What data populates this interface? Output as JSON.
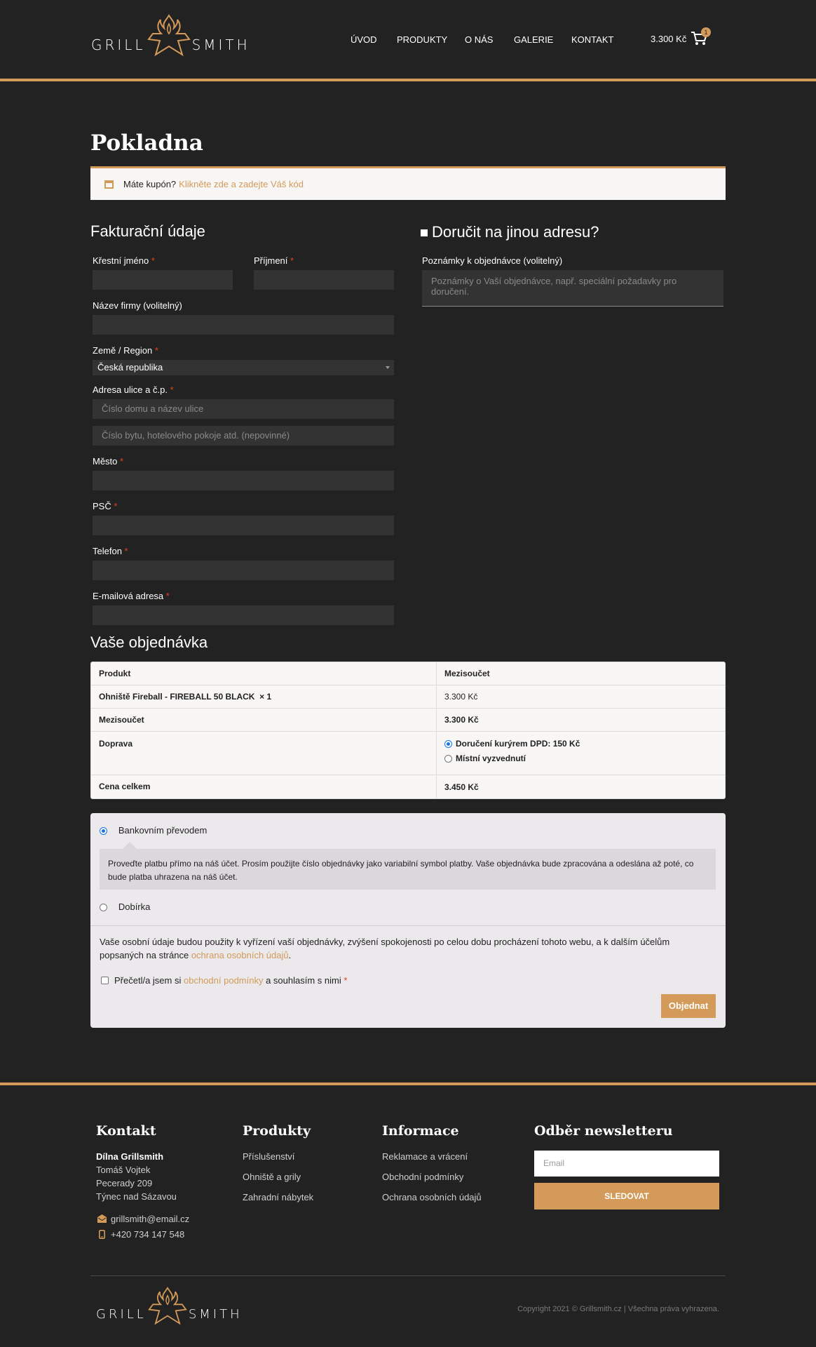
{
  "brand": {
    "left_word": "GRILL",
    "right_word": "SMITH"
  },
  "nav": {
    "items": [
      "ÚVOD",
      "PRODUKTY",
      "O NÁS",
      "GALERIE",
      "KONTAKT"
    ],
    "cart_amount": "3.300 Kč",
    "cart_count": "1"
  },
  "page_title": "Pokladna",
  "coupon": {
    "text": "Máte kupón?",
    "link": "Klikněte zde a zadejte Váš kód"
  },
  "billing": {
    "title": "Fakturační údaje",
    "first_name_label": "Křestní jméno",
    "last_name_label": "Příjmení",
    "company_label": "Název firmy (volitelný)",
    "country_label": "Země / Region",
    "country_value": "Česká republika",
    "street_label": "Adresa ulice a č.p.",
    "street_placeholder": "Číslo domu a název ulice",
    "street2_placeholder": "Číslo bytu, hotelového pokoje atd. (nepovinné)",
    "city_label": "Město",
    "zip_label": "PSČ",
    "phone_label": "Telefon",
    "email_label": "E-mailová adresa",
    "required_mark": "*"
  },
  "shipping": {
    "title": "Doručit na jinou adresu?",
    "notes_label": "Poznámky k objednávce (volitelný)",
    "notes_placeholder": "Poznámky o Vaší objednávce, např. speciální požadavky pro doručení."
  },
  "order": {
    "title": "Vaše objednávka",
    "col_product": "Produkt",
    "col_subtotal": "Mezisoučet",
    "item_name": "Ohniště Fireball - FIREBALL 50 BLACK",
    "item_qty": "× 1",
    "item_price": "3.300 Kč",
    "subtotal_label": "Mezisoučet",
    "subtotal_value": "3.300 Kč",
    "shipping_label": "Doprava",
    "shipping_option_1": "Doručení kurýrem DPD: 150 Kč",
    "shipping_option_2": "Místní vyzvednutí",
    "total_label": "Cena celkem",
    "total_value": "3.450 Kč"
  },
  "payment": {
    "option_1": "Bankovním převodem",
    "option_1_desc": "Proveďte platbu přímo na náš účet. Prosím použijte číslo objednávky jako variabilní symbol platby. Vaše objednávka bude zpracována a odeslána až poté, co bude platba uhrazena na náš účet.",
    "option_2": "Dobírka",
    "privacy_text": "Vaše osobní údaje budou použity k vyřízení vaší objednávky, zvýšení spokojenosti po celou dobu procházení tohoto webu, a k dalším účelům popsaných na stránce",
    "privacy_link": "ochrana osobních údajů",
    "privacy_end": ".",
    "terms_pre": "Přečetl/a jsem si",
    "terms_link": "obchodní podmínky",
    "terms_post": "a souhlasím s nimi",
    "button": "Objednat"
  },
  "footer": {
    "contact_title": "Kontakt",
    "contact_name": "Dílna Grillsmith",
    "contact_person": "Tomáš Vojtek",
    "contact_street": "Pecerady 209",
    "contact_city": "Týnec nad Sázavou",
    "contact_email": "grillsmith@email.cz",
    "contact_phone": "+420 734 147 548",
    "products_title": "Produkty",
    "products": [
      "Příslušenství",
      "Ohniště a grily",
      "Zahradní nábytek"
    ],
    "info_title": "Informace",
    "info": [
      "Reklamace a vrácení",
      "Obchodní podmínky",
      "Ochrana osobních údajů"
    ],
    "newsletter_title": "Odběr newsletteru",
    "newsletter_placeholder": "Email",
    "newsletter_button": "SLEDOVAT",
    "copyright": "Copyright 2021 © Grillsmith.cz | Všechna práva vyhrazena."
  },
  "colors": {
    "accent": "#d39a5a",
    "background": "#222222",
    "field": "#333333"
  }
}
